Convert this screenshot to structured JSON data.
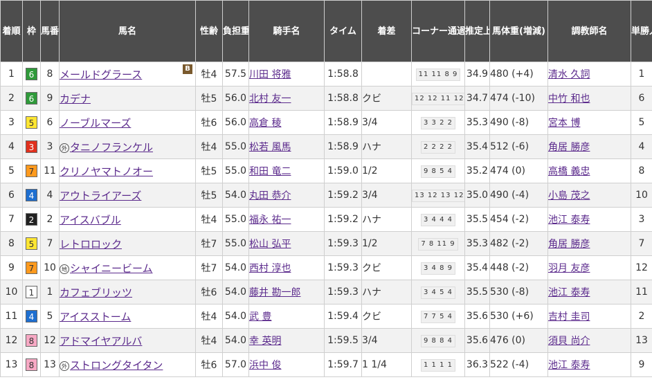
{
  "headers": {
    "rank": "着順",
    "waku": "枠",
    "umaban": "馬番",
    "horse": "馬名",
    "sexage": "性齢",
    "weight_carried": "負担重量",
    "jockey": "騎手名",
    "time": "タイム",
    "margin": "着差",
    "corner": "コーナー通過順位",
    "last3f": "推定上り",
    "body_weight": "馬体重(増減)",
    "trainer": "調教師名",
    "popularity": "単勝人気"
  },
  "waku_colors": {
    "1": {
      "bg": "#ffffff",
      "fg": "#333333"
    },
    "2": {
      "bg": "#222222",
      "fg": "#ffffff"
    },
    "3": {
      "bg": "#e0301e",
      "fg": "#ffffff"
    },
    "4": {
      "bg": "#1e6fd0",
      "fg": "#ffffff"
    },
    "5": {
      "bg": "#ffe633",
      "fg": "#333333"
    },
    "6": {
      "bg": "#2f9a3a",
      "fg": "#ffffff"
    },
    "7": {
      "bg": "#ff9a1e",
      "fg": "#333333"
    },
    "8": {
      "bg": "#f7a9c4",
      "fg": "#333333"
    }
  },
  "rows": [
    {
      "rank": "1",
      "waku": "6",
      "umaban": "8",
      "mark": "",
      "horse": "メールドグラース",
      "badge": "B",
      "sexage": "牡4",
      "weight": "57.5",
      "jockey": "川田 将雅",
      "time": "1:58.8",
      "margin": "",
      "corner": "11 11 8 9",
      "last3f": "34.9",
      "body_weight": "480 (+4)",
      "trainer": "清水 久詞",
      "pop": "1"
    },
    {
      "rank": "2",
      "waku": "6",
      "umaban": "9",
      "mark": "",
      "horse": "カデナ",
      "badge": "",
      "sexage": "牡5",
      "weight": "56.0",
      "jockey": "北村 友一",
      "time": "1:58.8",
      "margin": "クビ",
      "corner": "12 12 11 12",
      "last3f": "34.7",
      "body_weight": "474 (-10)",
      "trainer": "中竹 和也",
      "pop": "6"
    },
    {
      "rank": "3",
      "waku": "5",
      "umaban": "6",
      "mark": "",
      "horse": "ノーブルマーズ",
      "badge": "",
      "sexage": "牡6",
      "weight": "56.0",
      "jockey": "高倉 稜",
      "time": "1:58.9",
      "margin": "3/4",
      "corner": "3 3 2 2",
      "last3f": "35.3",
      "body_weight": "490 (-8)",
      "trainer": "宮本 博",
      "pop": "5"
    },
    {
      "rank": "4",
      "waku": "3",
      "umaban": "3",
      "mark": "外",
      "horse": "タニノフランケル",
      "badge": "",
      "sexage": "牡4",
      "weight": "55.0",
      "jockey": "松若 風馬",
      "time": "1:58.9",
      "margin": "ハナ",
      "corner": "2 2 2 2",
      "last3f": "35.4",
      "body_weight": "512 (-6)",
      "trainer": "角居 勝彦",
      "pop": "4"
    },
    {
      "rank": "5",
      "waku": "7",
      "umaban": "11",
      "mark": "",
      "horse": "クリノヤマトノオー",
      "badge": "",
      "sexage": "牡5",
      "weight": "55.0",
      "jockey": "和田 竜二",
      "time": "1:59.0",
      "margin": "1/2",
      "corner": "9 8 5 4",
      "last3f": "35.2",
      "body_weight": "474 (0)",
      "trainer": "高橋 義忠",
      "pop": "8"
    },
    {
      "rank": "6",
      "waku": "4",
      "umaban": "4",
      "mark": "",
      "horse": "アウトライアーズ",
      "badge": "",
      "sexage": "牡5",
      "weight": "54.0",
      "jockey": "丸田 恭介",
      "time": "1:59.2",
      "margin": "3/4",
      "corner": "13 12 13 12",
      "last3f": "35.0",
      "body_weight": "490 (-4)",
      "trainer": "小島 茂之",
      "pop": "10"
    },
    {
      "rank": "7",
      "waku": "2",
      "umaban": "2",
      "mark": "",
      "horse": "アイスバブル",
      "badge": "",
      "sexage": "牡4",
      "weight": "55.0",
      "jockey": "福永 祐一",
      "time": "1:59.2",
      "margin": "ハナ",
      "corner": "3 4 4 4",
      "last3f": "35.5",
      "body_weight": "454 (-2)",
      "trainer": "池江 泰寿",
      "pop": "3"
    },
    {
      "rank": "8",
      "waku": "5",
      "umaban": "7",
      "mark": "",
      "horse": "レトロロック",
      "badge": "",
      "sexage": "牡7",
      "weight": "55.0",
      "jockey": "松山 弘平",
      "time": "1:59.3",
      "margin": "1/2",
      "corner": "7 8 11 9",
      "last3f": "35.3",
      "body_weight": "482 (-2)",
      "trainer": "角居 勝彦",
      "pop": "7"
    },
    {
      "rank": "9",
      "waku": "7",
      "umaban": "10",
      "mark": "地",
      "horse": "シャイニービーム",
      "badge": "",
      "sexage": "牡7",
      "weight": "54.0",
      "jockey": "西村 淳也",
      "time": "1:59.3",
      "margin": "クビ",
      "corner": "3 4 8 9",
      "last3f": "35.4",
      "body_weight": "448 (-2)",
      "trainer": "羽月 友彦",
      "pop": "12"
    },
    {
      "rank": "10",
      "waku": "1",
      "umaban": "1",
      "mark": "",
      "horse": "カフェブリッツ",
      "badge": "",
      "sexage": "牡6",
      "weight": "54.0",
      "jockey": "藤井 勘一郎",
      "time": "1:59.3",
      "margin": "ハナ",
      "corner": "3 4 5 4",
      "last3f": "35.5",
      "body_weight": "530 (-8)",
      "trainer": "池江 泰寿",
      "pop": "11"
    },
    {
      "rank": "11",
      "waku": "4",
      "umaban": "5",
      "mark": "",
      "horse": "アイスストーム",
      "badge": "",
      "sexage": "牡4",
      "weight": "54.0",
      "jockey": "武 豊",
      "time": "1:59.4",
      "margin": "クビ",
      "corner": "7 7 5 4",
      "last3f": "35.6",
      "body_weight": "530 (+6)",
      "trainer": "吉村 圭司",
      "pop": "2"
    },
    {
      "rank": "12",
      "waku": "8",
      "umaban": "12",
      "mark": "",
      "horse": "アドマイヤアルバ",
      "badge": "",
      "sexage": "牡4",
      "weight": "54.0",
      "jockey": "幸 英明",
      "time": "1:59.5",
      "margin": "3/4",
      "corner": "9 8 8 4",
      "last3f": "35.6",
      "body_weight": "476 (0)",
      "trainer": "須貝 尚介",
      "pop": "13"
    },
    {
      "rank": "13",
      "waku": "8",
      "umaban": "13",
      "mark": "外",
      "horse": "ストロングタイタン",
      "badge": "",
      "sexage": "牡6",
      "weight": "57.0",
      "jockey": "浜中 俊",
      "time": "1:59.7",
      "margin": "1 1/4",
      "corner": "1 1 1 1",
      "last3f": "36.3",
      "body_weight": "522 (-4)",
      "trainer": "池江 泰寿",
      "pop": "9"
    }
  ]
}
